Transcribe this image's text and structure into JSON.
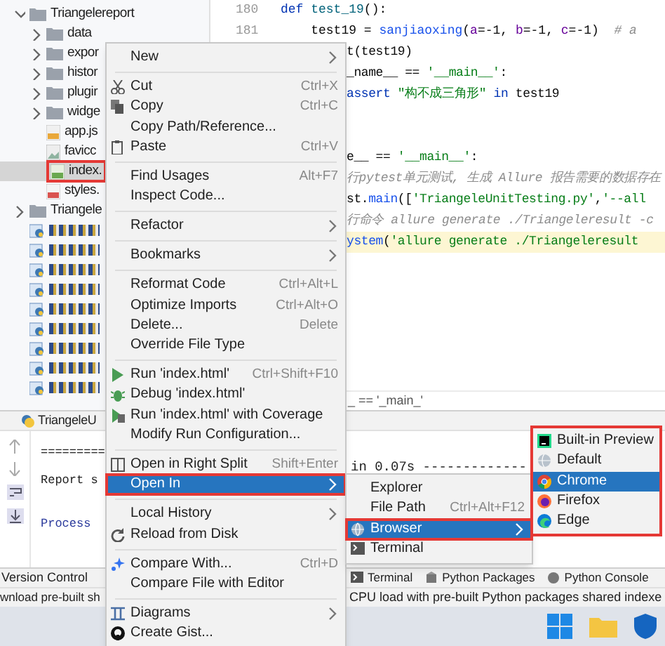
{
  "project_tree": [
    {
      "label": "Triangelereport",
      "kind": "folder",
      "expanded": true,
      "selected": false,
      "annotated": false,
      "children": [
        {
          "label": "data",
          "kind": "folder",
          "expanded": false,
          "selected": false,
          "annotated": false
        },
        {
          "label": "expor",
          "kind": "folder",
          "expanded": false,
          "selected": false,
          "annotated": false
        },
        {
          "label": "histor",
          "kind": "folder",
          "expanded": false,
          "selected": false,
          "annotated": false
        },
        {
          "label": "plugir",
          "kind": "folder",
          "expanded": false,
          "selected": false,
          "annotated": false
        },
        {
          "label": "widge",
          "kind": "folder",
          "expanded": false,
          "selected": false,
          "annotated": false
        },
        {
          "label": "app.js",
          "kind": "js",
          "selected": false,
          "annotated": false
        },
        {
          "label": "favicc",
          "kind": "image",
          "selected": false,
          "annotated": false
        },
        {
          "label": "index.",
          "kind": "html",
          "selected": true,
          "annotated": true
        },
        {
          "label": "styles.",
          "kind": "css",
          "selected": false,
          "annotated": false
        }
      ]
    },
    {
      "label": "Triangele",
      "kind": "folder",
      "expanded": false,
      "selected": false,
      "annotated": false
    },
    {
      "kind": "obscured"
    },
    {
      "kind": "obscured"
    },
    {
      "kind": "obscured"
    },
    {
      "kind": "obscured"
    },
    {
      "kind": "obscured"
    },
    {
      "kind": "obscured"
    },
    {
      "kind": "obscured"
    },
    {
      "kind": "obscured"
    },
    {
      "kind": "obscured"
    }
  ],
  "editor": {
    "lines": [
      {
        "number": "180",
        "segments": [
          {
            "kind": "keyword",
            "text": "def "
          },
          {
            "kind": "func",
            "text": "test_19"
          },
          {
            "kind": "plain",
            "text": "():"
          }
        ]
      },
      {
        "number": "181",
        "segments": [
          {
            "kind": "plain",
            "text": "    test19 = "
          },
          {
            "kind": "call",
            "text": "sanjiaoxing"
          },
          {
            "kind": "plain",
            "text": "("
          },
          {
            "kind": "param",
            "text": "a"
          },
          {
            "kind": "plain",
            "text": "=-1, "
          },
          {
            "kind": "param",
            "text": "b"
          },
          {
            "kind": "plain",
            "text": "=-1, "
          },
          {
            "kind": "param",
            "text": "c"
          },
          {
            "kind": "plain",
            "text": "=-1)  "
          },
          {
            "kind": "comment",
            "text": "# a"
          }
        ]
      }
    ],
    "fragments": [
      {
        "highlighted": false,
        "segments": [
          {
            "kind": "plain",
            "text": "t(test19)"
          }
        ]
      },
      {
        "highlighted": false,
        "segments": [
          {
            "kind": "plain",
            "text": "_name__ == "
          },
          {
            "kind": "string",
            "text": "'__main__'"
          },
          {
            "kind": "plain",
            "text": ":"
          }
        ]
      },
      {
        "highlighted": false,
        "segments": [
          {
            "kind": "keyword",
            "text": "assert "
          },
          {
            "kind": "string",
            "text": "\"构不成三角形\""
          },
          {
            "kind": "keyword",
            "text": " in "
          },
          {
            "kind": "plain",
            "text": "test19"
          }
        ]
      },
      {
        "highlighted": false,
        "segments": [
          {
            "kind": "plain",
            "text": "e__ == "
          },
          {
            "kind": "string",
            "text": "'__main__'"
          },
          {
            "kind": "plain",
            "text": ":"
          }
        ]
      },
      {
        "highlighted": false,
        "segments": [
          {
            "kind": "comment",
            "text": "行pytest单元测试, 生成 Allure 报告需要的数据存在"
          }
        ]
      },
      {
        "highlighted": false,
        "segments": [
          {
            "kind": "plain",
            "text": "st."
          },
          {
            "kind": "call",
            "text": "main"
          },
          {
            "kind": "plain",
            "text": "(["
          },
          {
            "kind": "string",
            "text": "'TriangeleUnitTesting.py'"
          },
          {
            "kind": "plain",
            "text": ","
          },
          {
            "kind": "string",
            "text": "'--all"
          }
        ]
      },
      {
        "highlighted": false,
        "segments": [
          {
            "kind": "comment",
            "text": "行命令 allure generate ./Triangeleresult -c"
          }
        ]
      },
      {
        "highlighted": true,
        "segments": [
          {
            "kind": "call",
            "text": "ystem"
          },
          {
            "kind": "plain",
            "text": "("
          },
          {
            "kind": "string",
            "text": "'allure generate ./Triangeleresult"
          }
        ]
      }
    ],
    "breadcrumb": "_ == '_main_'"
  },
  "run_panel": {
    "tab": "TriangeleU",
    "lines": [
      "=========",
      "Report s",
      "Process"
    ],
    "right_text": "in 0.07s -------------"
  },
  "context_menu": [
    {
      "kind": "item",
      "label": "New",
      "submenu": true,
      "selected": false,
      "annotated": false
    },
    {
      "kind": "separator"
    },
    {
      "kind": "item",
      "label": "Cut",
      "shortcut": "Ctrl+X",
      "selected": false,
      "annotated": false
    },
    {
      "kind": "item",
      "label": "Copy",
      "shortcut": "Ctrl+C",
      "selected": false,
      "annotated": false
    },
    {
      "kind": "item",
      "label": "Copy Path/Reference...",
      "selected": false,
      "annotated": false
    },
    {
      "kind": "item",
      "label": "Paste",
      "shortcut": "Ctrl+V",
      "selected": false,
      "annotated": false
    },
    {
      "kind": "separator"
    },
    {
      "kind": "item",
      "label": "Find Usages",
      "shortcut": "Alt+F7",
      "selected": false,
      "annotated": false
    },
    {
      "kind": "item",
      "label": "Inspect Code...",
      "selected": false,
      "annotated": false
    },
    {
      "kind": "separator"
    },
    {
      "kind": "item",
      "label": "Refactor",
      "submenu": true,
      "selected": false,
      "annotated": false
    },
    {
      "kind": "separator"
    },
    {
      "kind": "item",
      "label": "Bookmarks",
      "submenu": true,
      "selected": false,
      "annotated": false
    },
    {
      "kind": "separator"
    },
    {
      "kind": "item",
      "label": "Reformat Code",
      "shortcut": "Ctrl+Alt+L",
      "selected": false,
      "annotated": false
    },
    {
      "kind": "item",
      "label": "Optimize Imports",
      "shortcut": "Ctrl+Alt+O",
      "selected": false,
      "annotated": false
    },
    {
      "kind": "item",
      "label": "Delete...",
      "shortcut": "Delete",
      "selected": false,
      "annotated": false
    },
    {
      "kind": "item",
      "label": "Override File Type",
      "selected": false,
      "annotated": false
    },
    {
      "kind": "separator"
    },
    {
      "kind": "item",
      "label": "Run 'index.html'",
      "shortcut": "Ctrl+Shift+F10",
      "selected": false,
      "annotated": false
    },
    {
      "kind": "item",
      "label": "Debug 'index.html'",
      "selected": false,
      "annotated": false
    },
    {
      "kind": "item",
      "label": "Run 'index.html' with Coverage",
      "selected": false,
      "annotated": false
    },
    {
      "kind": "item",
      "label": "Modify Run Configuration...",
      "selected": false,
      "annotated": false
    },
    {
      "kind": "separator"
    },
    {
      "kind": "item",
      "label": "Open in Right Split",
      "shortcut": "Shift+Enter",
      "selected": false,
      "annotated": false
    },
    {
      "kind": "item",
      "label": "Open In",
      "submenu": true,
      "selected": true,
      "annotated": true
    },
    {
      "kind": "separator"
    },
    {
      "kind": "item",
      "label": "Local History",
      "submenu": true,
      "selected": false,
      "annotated": false
    },
    {
      "kind": "item",
      "label": "Reload from Disk",
      "selected": false,
      "annotated": false
    },
    {
      "kind": "separator"
    },
    {
      "kind": "item",
      "label": "Compare With...",
      "shortcut": "Ctrl+D",
      "selected": false,
      "annotated": false
    },
    {
      "kind": "item",
      "label": "Compare File with Editor",
      "selected": false,
      "annotated": false
    },
    {
      "kind": "separator"
    },
    {
      "kind": "item",
      "label": "Diagrams",
      "submenu": true,
      "selected": false,
      "annotated": false
    },
    {
      "kind": "item",
      "label": "Create Gist...",
      "selected": false,
      "annotated": false
    }
  ],
  "open_in_menu": [
    {
      "label": "Explorer",
      "selected": false,
      "annotated": false
    },
    {
      "label": "File Path",
      "shortcut": "Ctrl+Alt+F12",
      "selected": false,
      "annotated": false
    },
    {
      "label": "Browser",
      "submenu": true,
      "selected": true,
      "annotated": true
    },
    {
      "label": "Terminal",
      "selected": false,
      "annotated": false
    }
  ],
  "browser_menu": {
    "annotated": true,
    "items": [
      {
        "label": "Built-in Preview",
        "selected": false
      },
      {
        "label": "Default",
        "selected": false
      },
      {
        "label": "Chrome",
        "selected": true
      },
      {
        "label": "Firefox",
        "selected": false
      },
      {
        "label": "Edge",
        "selected": false
      }
    ]
  },
  "tool_window_bar": {
    "left": "Version Control",
    "right": [
      "Terminal",
      "Python Packages",
      "Python Console"
    ]
  },
  "status_bar": {
    "left": "wnload pre-built sh",
    "right": "CPU load with pre-built Python packages shared indexe"
  }
}
